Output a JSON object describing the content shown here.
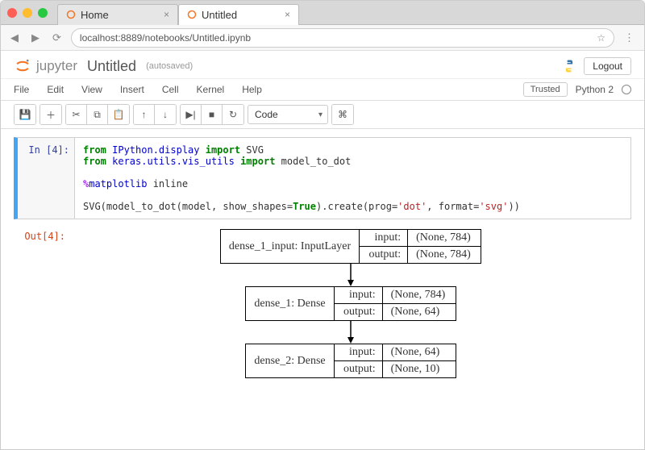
{
  "browser": {
    "tabs": [
      {
        "title": "Home",
        "active": false
      },
      {
        "title": "Untitled",
        "active": true
      }
    ],
    "url": "localhost:8889/notebooks/Untitled.ipynb"
  },
  "header": {
    "brand": "jupyter",
    "title": "Untitled",
    "autosave": "(autosaved)",
    "logout": "Logout"
  },
  "menu": {
    "items": [
      "File",
      "Edit",
      "View",
      "Insert",
      "Cell",
      "Kernel",
      "Help"
    ],
    "trusted": "Trusted",
    "kernel": "Python 2"
  },
  "toolbar": {
    "celltype": "Code"
  },
  "cell": {
    "in_prompt": "In [4]:",
    "out_prompt": "Out[4]:",
    "code_tokens": [
      {
        "t": "from ",
        "c": "kw-green"
      },
      {
        "t": "IPython.display ",
        "c": "kw-blue"
      },
      {
        "t": "import ",
        "c": "kw-green"
      },
      {
        "t": "SVG\n",
        "c": ""
      },
      {
        "t": "from ",
        "c": "kw-green"
      },
      {
        "t": "keras.utils.vis_utils ",
        "c": "kw-blue"
      },
      {
        "t": "import ",
        "c": "kw-green"
      },
      {
        "t": "model_to_dot\n\n",
        "c": ""
      },
      {
        "t": "%",
        "c": "kw-mag"
      },
      {
        "t": "matplotlib",
        "c": "kw-blue"
      },
      {
        "t": " inline\n\n",
        "c": ""
      },
      {
        "t": "SVG(model_to_dot(model, show_shapes",
        "c": ""
      },
      {
        "t": "=",
        "c": ""
      },
      {
        "t": "True",
        "c": "kw-green"
      },
      {
        "t": ").create(prog",
        "c": ""
      },
      {
        "t": "=",
        "c": ""
      },
      {
        "t": "'dot'",
        "c": "str"
      },
      {
        "t": ", format",
        "c": ""
      },
      {
        "t": "=",
        "c": ""
      },
      {
        "t": "'svg'",
        "c": "str"
      },
      {
        "t": "))",
        "c": ""
      }
    ]
  },
  "diagram": {
    "layers": [
      {
        "name": "dense_1_input: InputLayer",
        "input": "(None, 784)",
        "output": "(None, 784)"
      },
      {
        "name": "dense_1: Dense",
        "input": "(None, 784)",
        "output": "(None, 64)"
      },
      {
        "name": "dense_2: Dense",
        "input": "(None, 64)",
        "output": "(None, 10)"
      }
    ],
    "io_labels": {
      "input": "input:",
      "output": "output:"
    }
  }
}
